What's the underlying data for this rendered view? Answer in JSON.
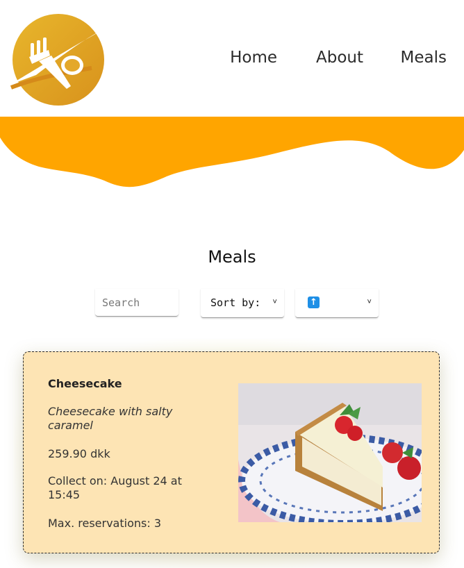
{
  "nav": {
    "items": [
      {
        "label": "Home"
      },
      {
        "label": "About"
      },
      {
        "label": "Meals"
      }
    ]
  },
  "colors": {
    "brand_orange": "#ffa500",
    "card_bg": "#fde4b4",
    "logo_gold": "#e6b429"
  },
  "page": {
    "title": "Meals"
  },
  "controls": {
    "search_placeholder": "Search",
    "sort_label": "Sort by:",
    "order_icon": "up-arrow-icon"
  },
  "meals": [
    {
      "name": "Cheesecake",
      "description": "Cheesecake with salty caramel",
      "price": "259.90 dkk",
      "collect": "Collect on: August 24 at 15:45",
      "max_reservations": "Max. reservations: 3",
      "image": "cheesecake-photo"
    }
  ]
}
